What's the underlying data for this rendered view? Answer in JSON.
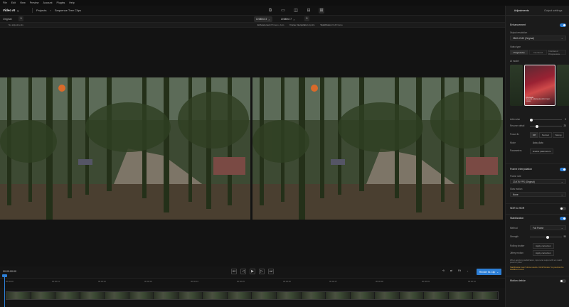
{
  "menubar": {
    "items": [
      "File",
      "Edit",
      "View",
      "Preview",
      "Account",
      "Plugins",
      "Help"
    ]
  },
  "topbar": {
    "logo": "Video AI",
    "logo_chevron": "⌄",
    "breadcrumb": [
      "Projects",
      "Sequence Tree Clips"
    ],
    "export_label": "Presets",
    "view_icons": [
      "split-view-icon",
      "side-by-side-icon",
      "overlay-icon",
      "compare-icon",
      "grid-icon"
    ]
  },
  "tabs": {
    "original": "Original",
    "add": "+",
    "video_tabs": [
      {
        "label": "Untitled 3",
        "close": "×"
      },
      {
        "label": "Untitled 7",
        "close": "×"
      }
    ],
    "add2": "+"
  },
  "infobar": {
    "left": "No adjustments",
    "items": [
      [
        "Enhancement",
        "Proteus, Auto"
      ],
      [
        "Frame Interpolation",
        "Apollo"
      ],
      [
        "Stabilization",
        "Full Frame"
      ]
    ]
  },
  "transport": {
    "timecode": "00:00:00:00",
    "zoom": "Fit",
    "render_label": "Render 5s Clip",
    "buttons": [
      "⏮",
      "◁",
      "▶",
      "▷",
      "⏭"
    ]
  },
  "ruler": [
    "00:00:00",
    "00:00:01",
    "00:00:02",
    "00:00:03",
    "00:00:04",
    "00:00:05",
    "00:00:06",
    "00:00:07",
    "00:00:08",
    "00:00:09",
    "00:00:10",
    "00:00:11",
    "00:00:12",
    "00:00:13",
    "00:00:14"
  ],
  "side": {
    "tabs": [
      "Adjustments",
      "Output settings"
    ],
    "enhancement": "Enhancement",
    "output_resolution_label": "Output resolution",
    "output_resolution": "3840×2160 (Original)",
    "video_type_label": "Video type",
    "video_type": [
      "Progressive",
      "Interlaced",
      "Interlaced Progressive"
    ],
    "ai_model_label": "AI model",
    "model_name": "Proteus",
    "model_desc": "General enhancement for most videos",
    "add_noise": "Add noise",
    "add_noise_val": "0",
    "recover_detail": "Recover detail",
    "recover_detail_val": "20",
    "focus_fix": "Focus fix",
    "focus_fix_opts": [
      "Off",
      "Normal",
      "Strong"
    ],
    "mode": "Mode",
    "mode_val": "Auto, Auto",
    "parameters": "Parameters",
    "parameters_val": "Enable parameters",
    "frame_interp": "Frame Interpolation",
    "frame_rate_label": "Frame rate",
    "frame_rate": "23.976 FPS (Original)",
    "slow_motion_label": "Slow motion",
    "slow_motion": "None",
    "sdr_hdr": "SDR to HDR",
    "stabilization": "Stabilization",
    "method_label": "Method",
    "method": "Full Frame",
    "strength_label": "Strength",
    "strength_val": "50",
    "strength_pct": 0.5,
    "rolling_shutter": "Rolling shutter",
    "rolling_val": "Apply correction",
    "reduce_motion": "Jittery motion",
    "reduce_val": "Apply correction",
    "note1": "When applying stabilization, input and output will not match pixel for pixel.",
    "note2": "Stabilization won't show results. Click 'Render' to preview the stabilized result.",
    "motion_deblur": "Motion deblur"
  }
}
